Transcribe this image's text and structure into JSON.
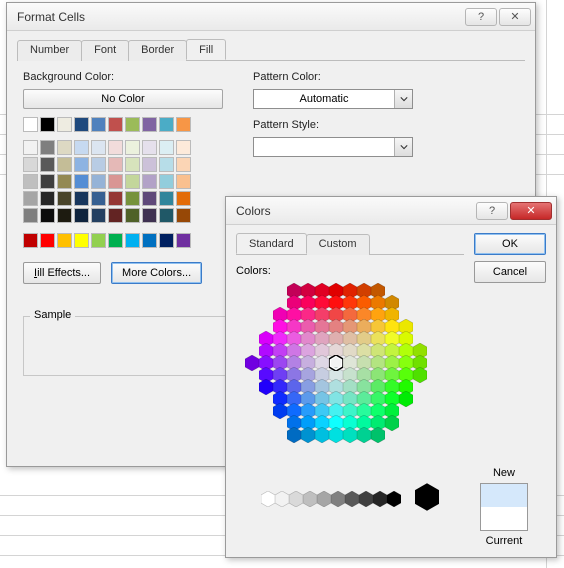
{
  "format_dialog": {
    "title": "Format Cells",
    "tabs": {
      "number": "Number",
      "font": "Font",
      "border": "Border",
      "fill": "Fill"
    },
    "active_tab": "Fill",
    "bg_label": "Background Color:",
    "no_color": "No Color",
    "pattern_color_label": "Pattern Color:",
    "pattern_color_value": "Automatic",
    "pattern_style_label": "Pattern Style:",
    "fill_effects": "Fill Effects...",
    "more_colors": "More Colors...",
    "sample_label": "Sample",
    "theme_row1": [
      "#ffffff",
      "#000000",
      "#eeece1",
      "#1f497d",
      "#4f81bd",
      "#c0504d",
      "#9bbb59",
      "#8064a2",
      "#4bacc6",
      "#f79646"
    ],
    "theme_tints": [
      [
        "#f2f2f2",
        "#7f7f7f",
        "#ddd9c3",
        "#c6d9f0",
        "#dbe5f1",
        "#f2dcdb",
        "#ebf1dd",
        "#e5e0ec",
        "#dbeef3",
        "#fdeada"
      ],
      [
        "#d8d8d8",
        "#595959",
        "#c4bd97",
        "#8db3e2",
        "#b8cce4",
        "#e5b9b7",
        "#d7e3bc",
        "#ccc1d9",
        "#b7dde8",
        "#fbd5b5"
      ],
      [
        "#bfbfbf",
        "#3f3f3f",
        "#938953",
        "#548dd4",
        "#95b3d7",
        "#d99694",
        "#c3d69b",
        "#b2a2c7",
        "#92cddc",
        "#fac08f"
      ],
      [
        "#a5a5a5",
        "#262626",
        "#494429",
        "#17365d",
        "#366092",
        "#953734",
        "#76923c",
        "#5f497a",
        "#31859b",
        "#e36c09"
      ],
      [
        "#7f7f7f",
        "#0c0c0c",
        "#1d1b10",
        "#0f243e",
        "#244061",
        "#632423",
        "#4f6128",
        "#3f3151",
        "#205867",
        "#974806"
      ]
    ],
    "standard_row": [
      "#c00000",
      "#ff0000",
      "#ffc000",
      "#ffff00",
      "#92d050",
      "#00b050",
      "#00b0f0",
      "#0070c0",
      "#002060",
      "#7030a0"
    ]
  },
  "colors_dialog": {
    "title": "Colors",
    "tab_standard": "Standard",
    "tab_custom": "Custom",
    "ok": "OK",
    "cancel": "Cancel",
    "colors_label": "Colors:",
    "new_label": "New",
    "current_label": "Current",
    "new_color": "#d5e8fb",
    "current_color": "#ffffff",
    "grays": [
      "#ffffff",
      "#f2f2f2",
      "#d9d9d9",
      "#bfbfbf",
      "#a6a6a6",
      "#808080",
      "#595959",
      "#404040",
      "#262626",
      "#000000"
    ]
  }
}
